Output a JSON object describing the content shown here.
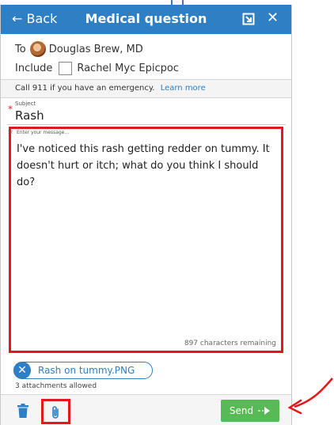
{
  "header": {
    "back_label": "← Back",
    "title": "Medical question",
    "close_label": "✕"
  },
  "recipient": {
    "to_label": "To",
    "name": "Douglas Brew, MD"
  },
  "include": {
    "label": "Include",
    "name": "Rachel Myc Epicpoc"
  },
  "emergency": {
    "text": "Call 911 if you have an emergency.",
    "link": "Learn more"
  },
  "subject": {
    "label": "Subject",
    "value": "Rash"
  },
  "message": {
    "placeholder": "Enter your message...",
    "text": "I've noticed this rash getting redder on tummy. It doesn't hurt or itch; what do you think I should do?",
    "chars_remaining": "897 characters remaining"
  },
  "attachment": {
    "file_name": "Rash on tummy.PNG",
    "remove_label": "✕",
    "allowed_text": "3 attachments allowed"
  },
  "footer": {
    "send_label": "Send"
  },
  "colors": {
    "header": "#2e7fc3",
    "send": "#58b957",
    "highlight": "#e01a1a"
  }
}
